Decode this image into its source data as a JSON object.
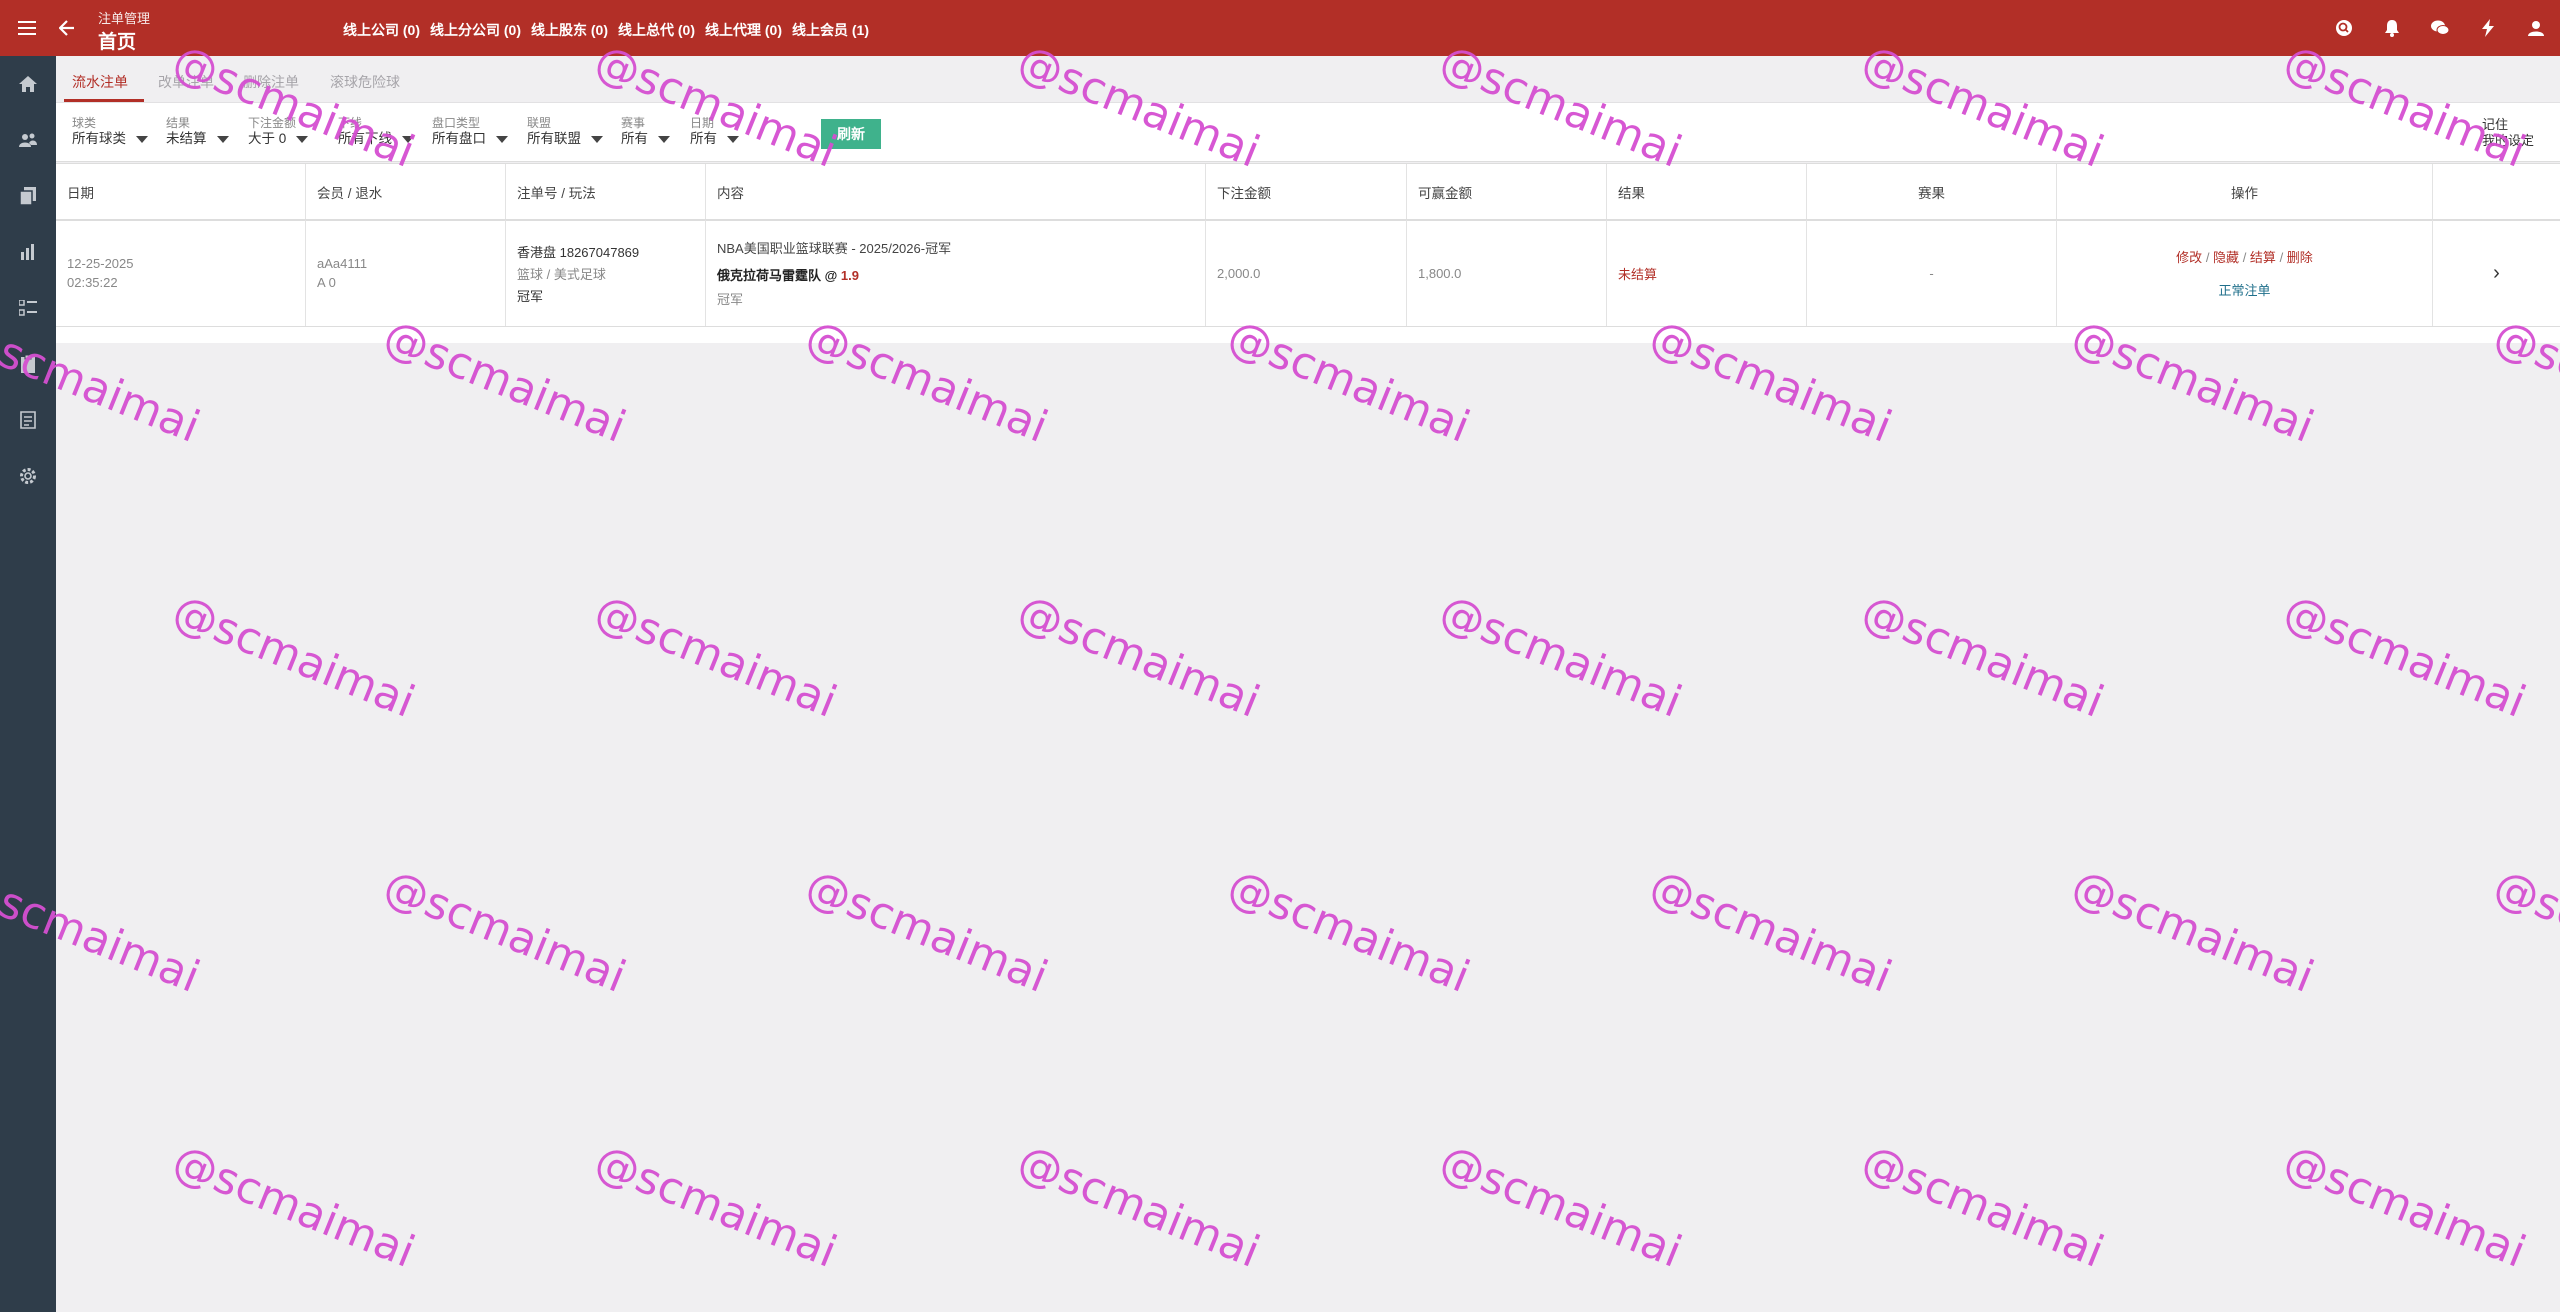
{
  "header": {
    "breadcrumb": "注单管理",
    "title": "首页",
    "links": [
      "线上公司 (0)",
      "线上分公司 (0)",
      "线上股东 (0)",
      "线上总代 (0)",
      "线上代理 (0)",
      "线上会员 (1)"
    ]
  },
  "tabs": [
    "流水注单",
    "改单注单",
    "删除注单",
    "滚球危险球"
  ],
  "filters": {
    "sport": {
      "label": "球类",
      "value": "所有球类"
    },
    "result": {
      "label": "结果",
      "value": "未结算"
    },
    "amount": {
      "label": "下注金额",
      "value": "大于 0"
    },
    "downline": {
      "label": "下线",
      "value": "所有下线"
    },
    "market": {
      "label": "盘口类型",
      "value": "所有盘口"
    },
    "league": {
      "label": "联盟",
      "value": "所有联盟"
    },
    "match": {
      "label": "赛事",
      "value": "所有"
    },
    "date": {
      "label": "日期",
      "value": "所有"
    },
    "refresh": "刷新",
    "remember_1": "记住",
    "remember_2": "我的设定"
  },
  "table": {
    "headers": [
      "日期",
      "会员 / 退水",
      "注单号 / 玩法",
      "内容",
      "下注金额",
      "可赢金额",
      "结果",
      "赛果",
      "操作"
    ],
    "row": {
      "date": "12-25-2025",
      "time": "02:35:22",
      "member": "aAa4111",
      "rebate": "A 0",
      "ticket": "香港盘 18267047869",
      "game": "篮球 / 美式足球",
      "bet_type": "冠军",
      "content_title": "NBA美国职业篮球联赛 - 2025/2026-冠军",
      "selection": "俄克拉荷马雷霆队 @",
      "odds": "1.9",
      "content_type": "冠军",
      "bet_amount": "2,000.0",
      "win_amount": "1,800.0",
      "result": "未结算",
      "score": "-",
      "actions": [
        "修改",
        "隐藏",
        "结算",
        "删除"
      ],
      "status": "正常注单"
    }
  },
  "watermark": "@scmaimai"
}
